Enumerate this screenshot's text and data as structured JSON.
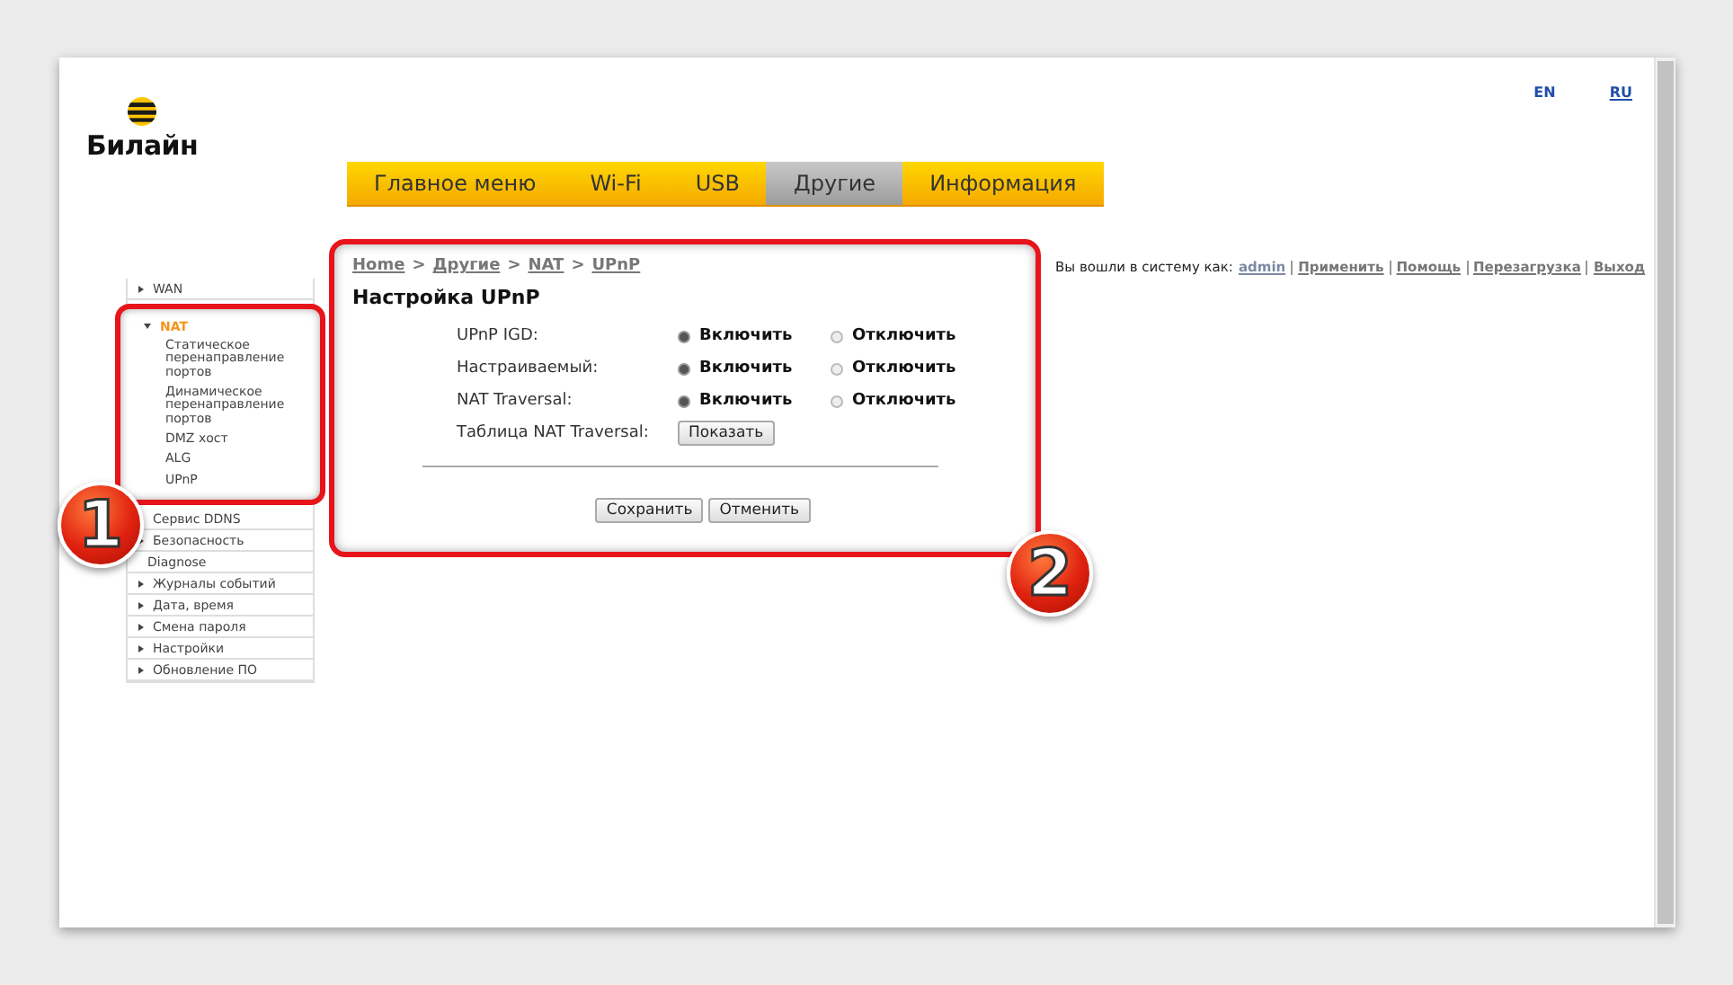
{
  "languages": [
    {
      "label": "EN",
      "selected": false
    },
    {
      "label": "RU",
      "selected": true
    }
  ],
  "logo": {
    "text": "Билайн"
  },
  "nav": [
    {
      "label": "Главное меню",
      "selected": false
    },
    {
      "label": "Wi-Fi",
      "selected": false
    },
    {
      "label": "USB",
      "selected": false
    },
    {
      "label": "Другие",
      "selected": true
    },
    {
      "label": "Информация",
      "selected": false
    }
  ],
  "sidebar": {
    "items": [
      {
        "label": "WAN",
        "kind": "group",
        "expanded": false
      },
      {
        "label": "NAT",
        "kind": "group",
        "expanded": true,
        "callout": "1",
        "children": [
          {
            "label": "Статическое перенаправление портов"
          },
          {
            "label": "Динамическое перенаправление портов"
          },
          {
            "label": "DMZ хост"
          },
          {
            "label": "ALG"
          },
          {
            "label": "UPnP"
          }
        ]
      },
      {
        "label": "Сервис DDNS",
        "kind": "group",
        "expanded": false
      },
      {
        "label": "Безопасность",
        "kind": "group",
        "expanded": false
      },
      {
        "label": "Diagnose",
        "kind": "link"
      },
      {
        "label": "Журналы событий",
        "kind": "group",
        "expanded": false
      },
      {
        "label": "Дата, время",
        "kind": "group",
        "expanded": false
      },
      {
        "label": "Смена пароля",
        "kind": "group",
        "expanded": false
      },
      {
        "label": "Настройки",
        "kind": "group",
        "expanded": false
      },
      {
        "label": "Обновление ПО",
        "kind": "group",
        "expanded": false
      }
    ]
  },
  "breadcrumb": [
    "Home",
    "Другие",
    "NAT",
    "UPnP"
  ],
  "breadcrumb_separator": ">",
  "user_bar": {
    "text": "Вы вошли в систему как:",
    "links": [
      "admin",
      "Применить",
      "Помощь",
      "Перезагрузка",
      "Выход"
    ]
  },
  "panel": {
    "title": "Настройка UPnP",
    "callout": "2",
    "rows": [
      {
        "kind": "radio",
        "label": "UPnP IGD:",
        "options": [
          {
            "label": "Включить",
            "selected": true
          },
          {
            "label": "Отключить",
            "selected": false
          }
        ]
      },
      {
        "kind": "radio",
        "label": "Настраиваемый:",
        "options": [
          {
            "label": "Включить",
            "selected": true
          },
          {
            "label": "Отключить",
            "selected": false
          }
        ]
      },
      {
        "kind": "radio",
        "label": "NAT Traversal:",
        "options": [
          {
            "label": "Включить",
            "selected": true
          },
          {
            "label": "Отключить",
            "selected": false
          }
        ]
      },
      {
        "kind": "button",
        "label": "Таблица NAT Traversal:",
        "button": "Показать"
      }
    ],
    "buttons": [
      "Сохранить",
      "Отменить"
    ]
  }
}
